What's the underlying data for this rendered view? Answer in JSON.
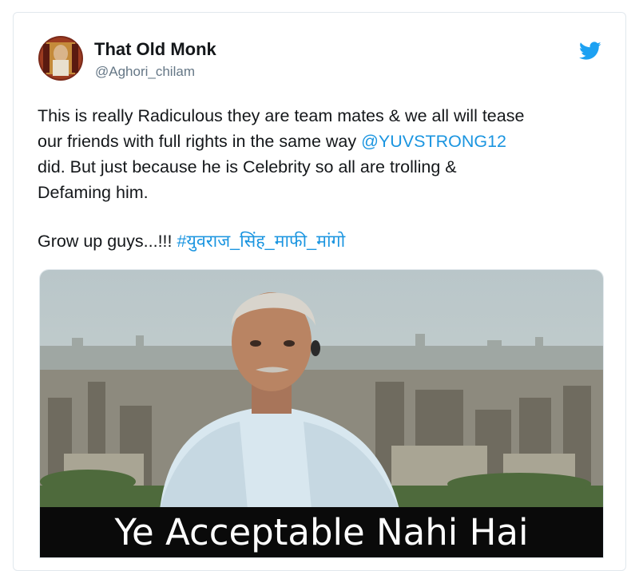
{
  "tweet": {
    "display_name": "That Old Monk",
    "handle": "@Aghori_chilam",
    "text_line1": "This is really Radiculous they are team mates & we all will tease",
    "text_line2_pre": "our friends with full rights in the same way ",
    "mention": "@YUVSTRONG12",
    "text_line3": "did. But just because he is Celebrity so all are trolling &",
    "text_line4": "Defaming him.",
    "text_line5_pre": "Grow up guys...!!! ",
    "hashtag": "#युवराज_सिंह_माफी_मांगो"
  },
  "media": {
    "caption": "Ye Acceptable Nahi Hai"
  },
  "icons": {
    "brand": "twitter-bird-icon",
    "avatar": "avatar"
  },
  "colors": {
    "link": "#1b95e0",
    "twitter_blue": "#1da1f2",
    "text": "#14171a",
    "secondary": "#657786"
  }
}
